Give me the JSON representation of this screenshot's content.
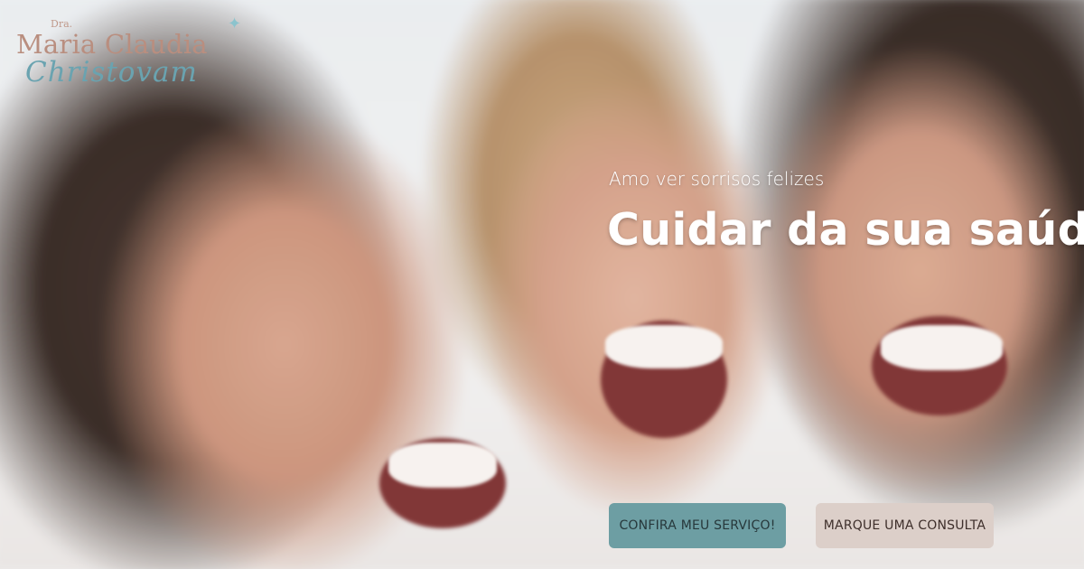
{
  "logo": {
    "prefix": "Dra.",
    "name": "Maria Claudia",
    "surname": "Christovam",
    "sparkle_icon": "sparkle-icon"
  },
  "hero": {
    "tagline": "Amo ver sorrisos felizes",
    "headline": "Cuidar da sua saúde"
  },
  "buttons": {
    "primary_label": "CONFIRA MEU SERVIÇO!",
    "secondary_label": "MARQUE UMA CONSULTA"
  },
  "colors": {
    "primary_button": "#6d9ea3",
    "secondary_button": "#dccfc9",
    "logo_rose": "#b98e7f",
    "logo_teal": "#6aa3b0"
  }
}
